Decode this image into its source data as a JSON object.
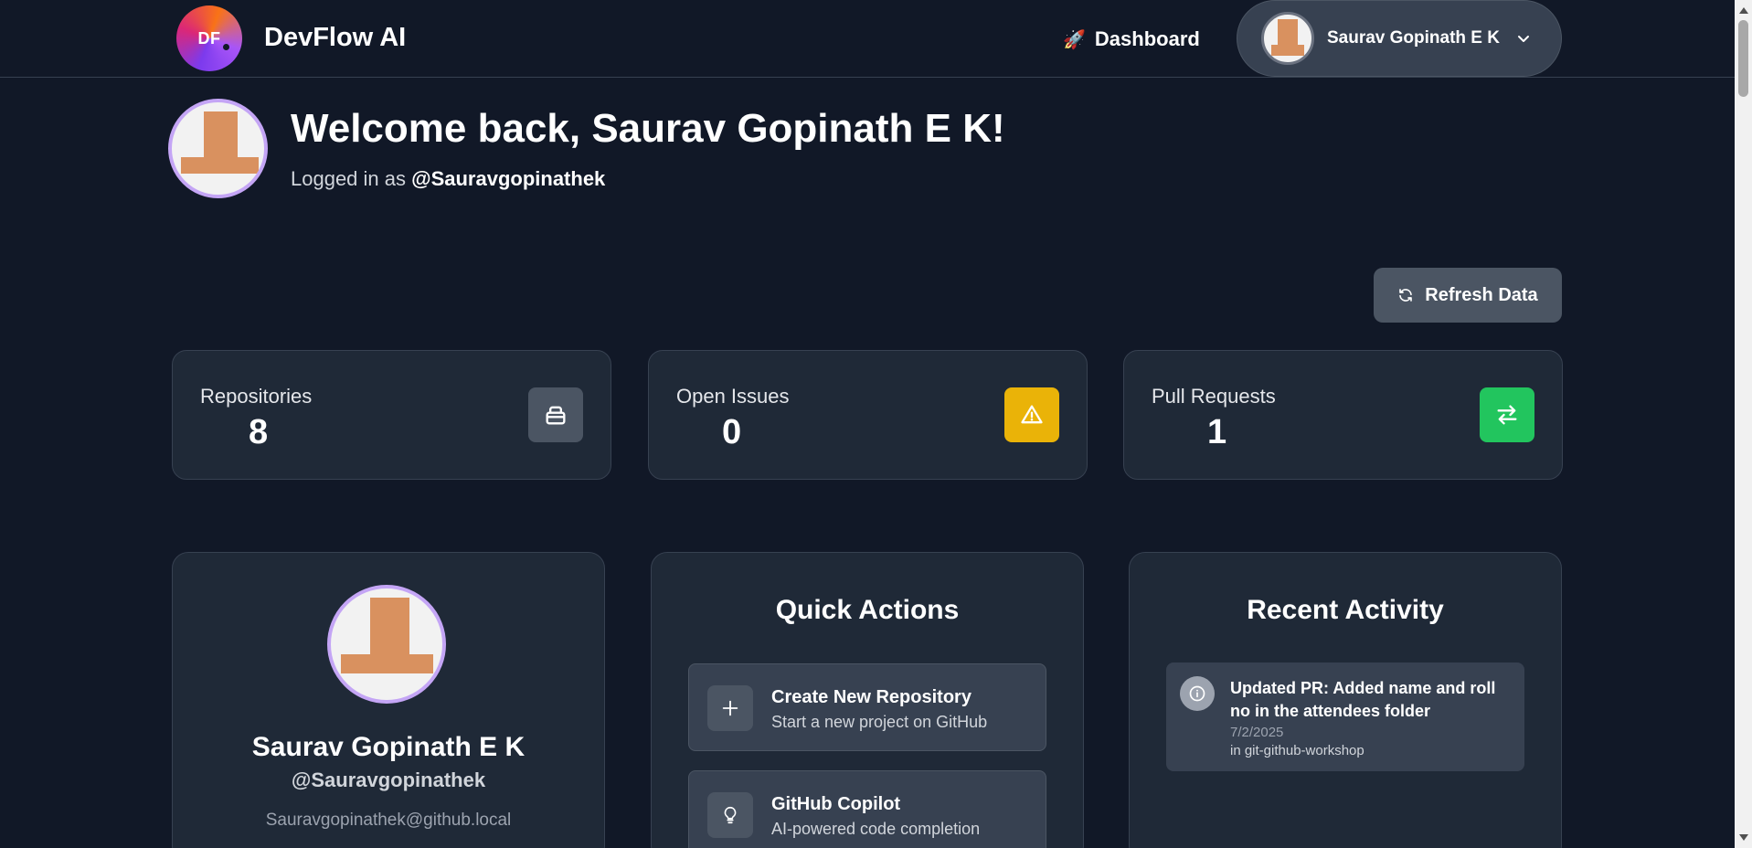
{
  "header": {
    "logo_text": "DF",
    "brand": "DevFlow AI",
    "nav_dashboard_emoji": "🚀",
    "nav_dashboard": "Dashboard",
    "user_name": "Saurav Gopinath E K"
  },
  "welcome": {
    "title": "Welcome back, Saurav Gopinath E K!",
    "logged_prefix": "Logged in as",
    "handle": "@Sauravgopinathek"
  },
  "refresh_label": "Refresh Data",
  "stats": [
    {
      "label": "Repositories",
      "value": "8",
      "icon": "repository-icon",
      "color": "#4b5563"
    },
    {
      "label": "Open Issues",
      "value": "0",
      "icon": "warning-icon",
      "color": "#eab308"
    },
    {
      "label": "Pull Requests",
      "value": "1",
      "icon": "pull-request-icon",
      "color": "#22c55e"
    }
  ],
  "profile": {
    "name": "Saurav Gopinath E K",
    "handle": "@Sauravgopinathek",
    "email": "Sauravgopinathek@github.local"
  },
  "quick_actions": {
    "title": "Quick Actions",
    "items": [
      {
        "title": "Create New Repository",
        "subtitle": "Start a new project on GitHub",
        "icon": "plus-icon"
      },
      {
        "title": "GitHub Copilot",
        "subtitle": "AI-powered code completion",
        "icon": "lightbulb-icon"
      }
    ]
  },
  "recent_activity": {
    "title": "Recent Activity",
    "items": [
      {
        "title": "Updated PR: Added name and roll no in the attendees folder",
        "date": "7/2/2025",
        "repo": "in git-github-workshop",
        "icon": "info-icon"
      }
    ]
  }
}
